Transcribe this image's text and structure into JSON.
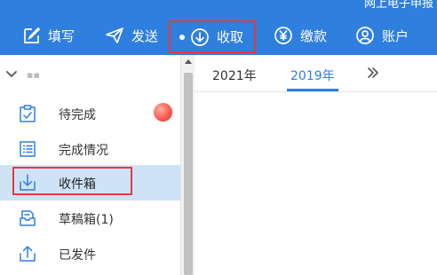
{
  "header": {
    "app_title": "网上电子申报",
    "bg_color": "#2f7fde",
    "nav": [
      {
        "label": "填写",
        "icon": "edit-icon"
      },
      {
        "label": "发送",
        "icon": "send-icon"
      },
      {
        "label": "收取",
        "icon": "download-circle-icon",
        "active": true
      },
      {
        "label": "缴款",
        "icon": "yen-circle-icon"
      },
      {
        "label": "账户",
        "icon": "user-icon"
      }
    ]
  },
  "sidebar": {
    "account_name": "▪▪",
    "items": [
      {
        "label": "待完成",
        "icon": "clipboard-check-icon",
        "has_badge": true
      },
      {
        "label": "完成情况",
        "icon": "list-icon"
      },
      {
        "label": "收件箱",
        "icon": "inbox-download-icon",
        "selected": true
      },
      {
        "label": "草稿箱(1)",
        "icon": "drafts-icon"
      },
      {
        "label": "已发件",
        "icon": "upload-icon"
      }
    ]
  },
  "content": {
    "tabs": [
      {
        "label": "2021年"
      },
      {
        "label": "2019年",
        "active": true
      }
    ],
    "more_label": "»"
  },
  "colors": {
    "accent": "#2f7fde",
    "highlight": "#e23a3a",
    "selected_bg": "#cfe3f8"
  }
}
